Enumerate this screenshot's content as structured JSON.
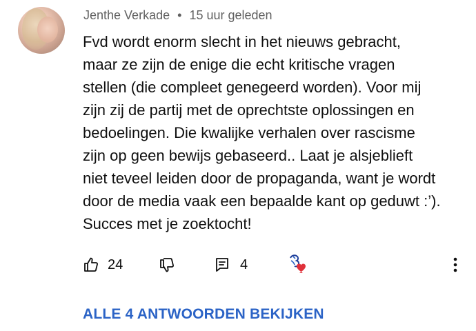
{
  "comment": {
    "author": "Jenthe Verkade",
    "separator": "•",
    "timestamp": "15 uur geleden",
    "text": "Fvd wordt enorm slecht in het nieuws gebracht,\nmaar ze zijn de enige die echt kritische vragen\nstellen (die compleet genegeerd worden). Voor mij\nzijn zij de partij met de oprechtste oplossingen en\nbedoelingen. Die kwalijke verhalen over rascisme\nzijn op geen bewijs gebaseerd.. Laat je alsjeblieft\nniet teveel leiden door de propaganda, want je wordt\ndoor de media vaak een bepaalde kant op geduwt :’).\nSucces met je zoektocht!"
  },
  "actions": {
    "like_count": "24",
    "reply_count": "4",
    "like_icon": "thumbs-up-icon",
    "dislike_icon": "thumbs-down-icon",
    "reply_icon": "comment-icon",
    "creator_heart_icon": "creator-heart-icon",
    "more_icon": "more-vertical-icon"
  },
  "view_replies_label": "ALLE 4 ANTWOORDEN BEKIJKEN",
  "colors": {
    "text": "#0f0f0f",
    "meta": "#606060",
    "link": "#2b63c6",
    "heart": "#e0313a"
  }
}
